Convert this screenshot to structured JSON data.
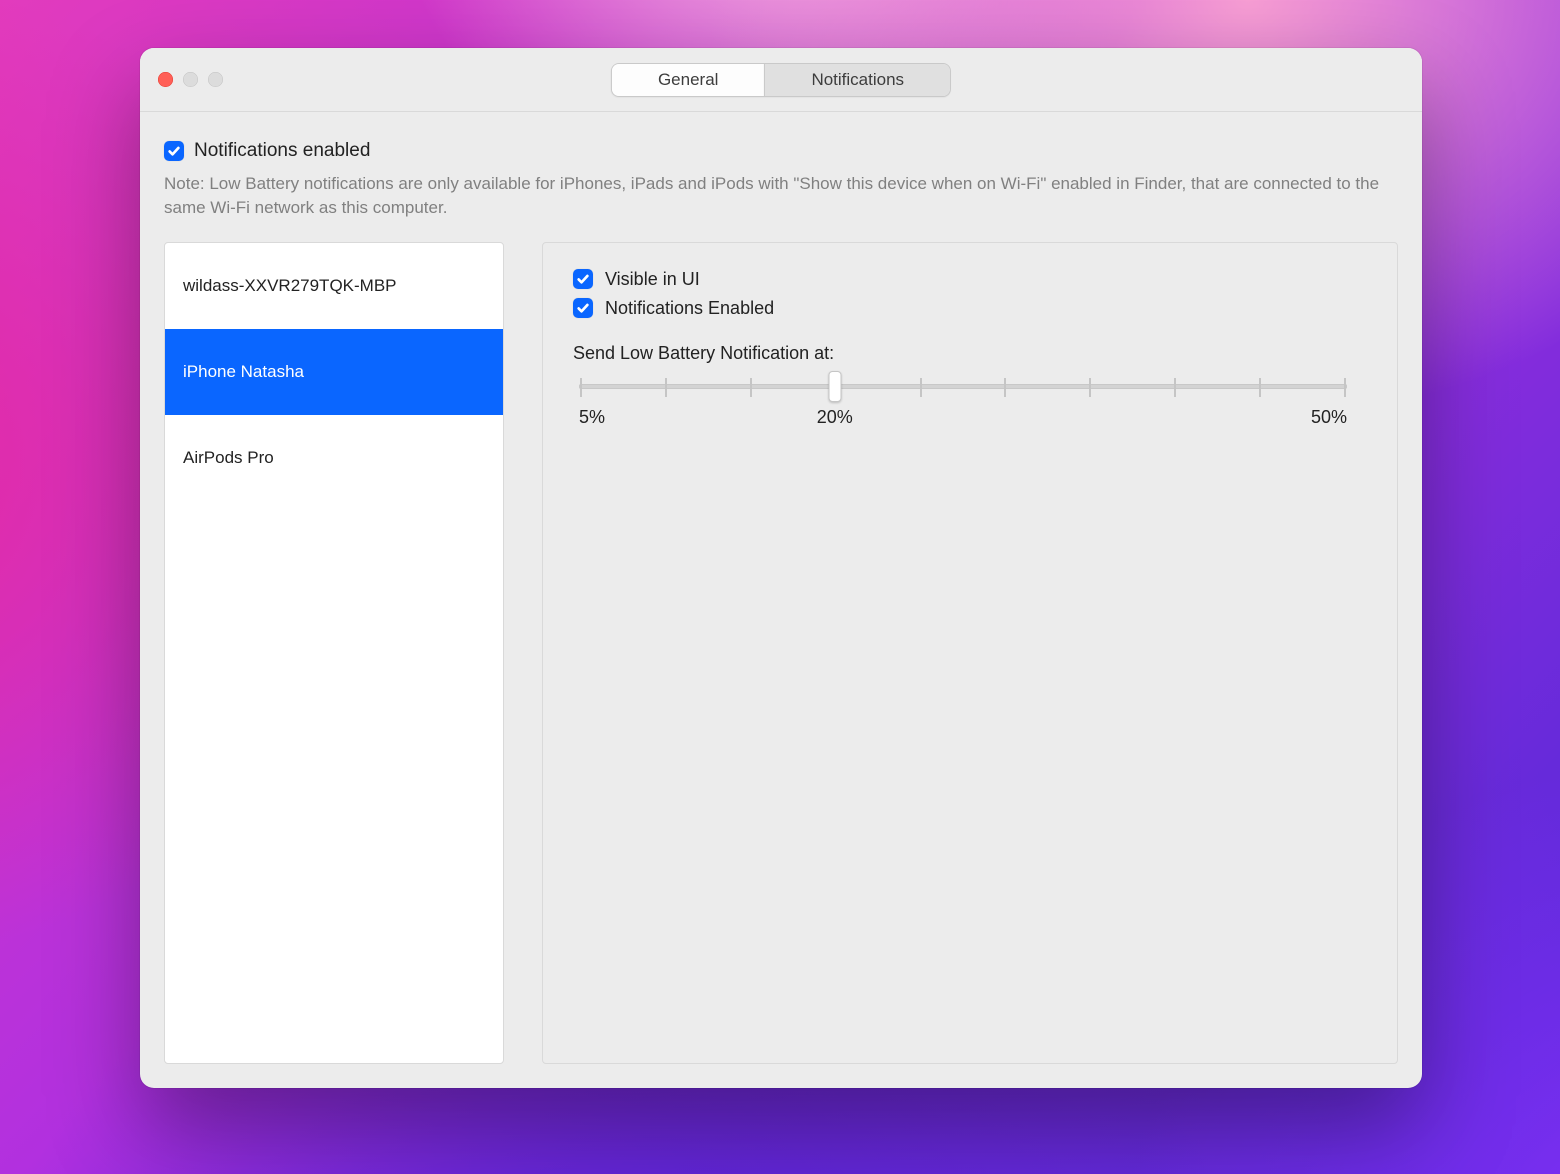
{
  "window": {
    "tabs": {
      "general": "General",
      "notifications": "Notifications",
      "active": "notifications"
    }
  },
  "top": {
    "notifications_enabled_label": "Notifications enabled",
    "notifications_enabled_checked": true,
    "note": "Note: Low Battery notifications are only available for iPhones, iPads and iPods with \"Show this device when on Wi-Fi\" enabled in Finder, that are connected to the same Wi-Fi network as this computer."
  },
  "devices": [
    {
      "name": "wildass-XXVR279TQK-MBP",
      "selected": false
    },
    {
      "name": "iPhone Natasha",
      "selected": true
    },
    {
      "name": "AirPods Pro",
      "selected": false
    }
  ],
  "detail": {
    "visible_label": "Visible in UI",
    "visible_checked": true,
    "notif_label": "Notifications Enabled",
    "notif_checked": true,
    "slider_title": "Send Low Battery Notification at:",
    "slider": {
      "min_pct": 5,
      "max_pct": 50,
      "step_pct": 5,
      "value_pct": 20,
      "tick_count": 10,
      "labels": {
        "min": "5%",
        "mid": "20%",
        "mid_pct_of_track": 33.3,
        "max": "50%"
      }
    }
  },
  "colors": {
    "accent": "#0a66ff"
  }
}
